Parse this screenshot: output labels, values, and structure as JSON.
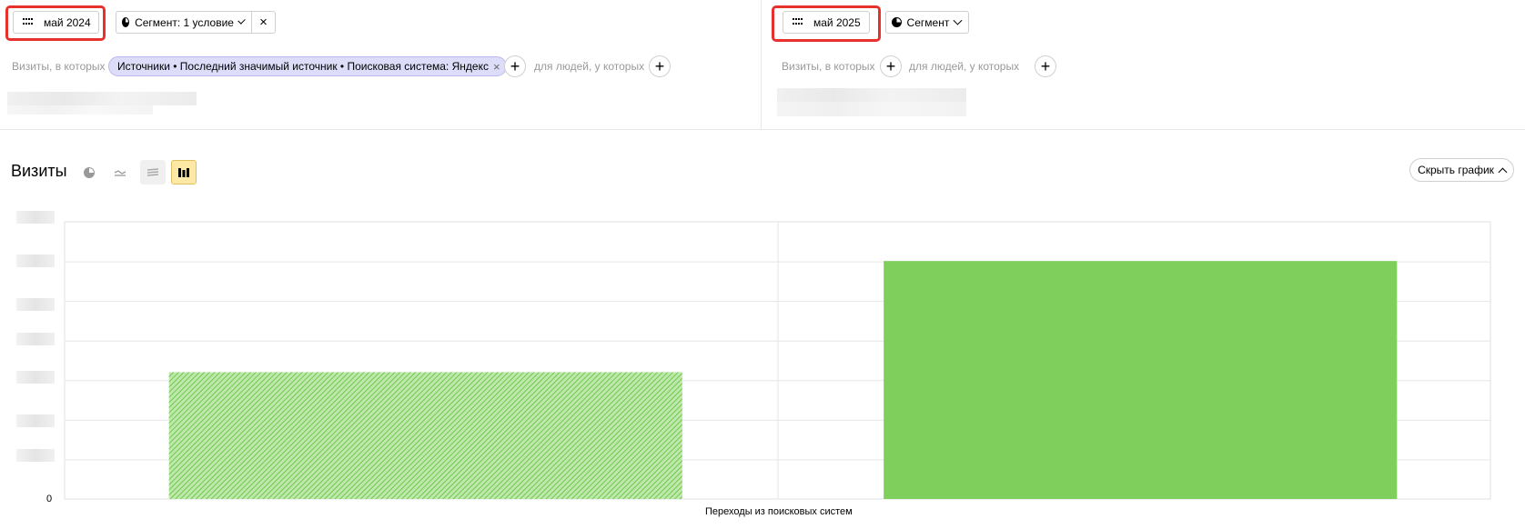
{
  "left_panel": {
    "period_label": "май 2024",
    "segment_label": "Сегмент: 1 условие",
    "visits_label": "Визиты, в которых",
    "condition_chip": "Источники • Последний значимый источник • Поисковая система: Яндекс",
    "people_label": "для людей, у которых"
  },
  "right_panel": {
    "period_label": "май 2025",
    "segment_label": "Сегмент",
    "visits_label": "Визиты, в которых",
    "people_label": "для людей, у которых"
  },
  "chart_header": {
    "title": "Визиты",
    "hide_chart_label": "Скрыть график",
    "view_icons": [
      "pie-icon",
      "line-icon",
      "area-icon",
      "bar-icon"
    ]
  },
  "colors": {
    "highlight": "#e8312d",
    "bar_fill": "#7ecf5c",
    "active_view": "#fde9a5",
    "chip_bg": "#ddddfa"
  },
  "chart_data": {
    "type": "bar",
    "categories": [
      "Переходы из поисковых систем"
    ],
    "series": [
      {
        "values": [
          0.485
        ],
        "pattern": "hatched"
      },
      {
        "values": [
          0.91
        ],
        "pattern": "solid"
      }
    ],
    "ylim": [
      0,
      1.06
    ],
    "y_tick_labels": [
      "0"
    ],
    "grid": true
  }
}
